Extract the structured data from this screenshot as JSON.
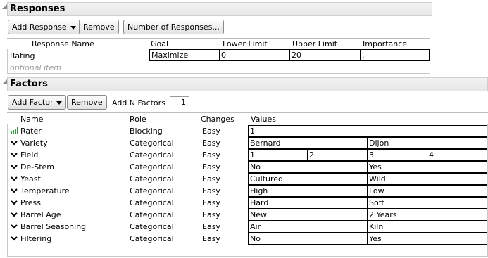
{
  "responses": {
    "title": "Responses",
    "buttons": {
      "add": "Add Response",
      "remove": "Remove",
      "number": "Number of Responses..."
    },
    "columns": [
      "Response Name",
      "Goal",
      "Lower Limit",
      "Upper Limit",
      "Importance"
    ],
    "row": {
      "name": "Rating",
      "goal": "Maximize",
      "lower": "0",
      "upper": "20",
      "importance": "."
    },
    "optional": "optional item"
  },
  "factors": {
    "title": "Factors",
    "buttons": {
      "add": "Add Factor",
      "remove": "Remove",
      "add_n_label": "Add N Factors",
      "add_n_value": "1"
    },
    "columns": [
      "Name",
      "Role",
      "Changes",
      "Values"
    ],
    "rows": [
      {
        "name": "Rater",
        "role": "Blocking",
        "changes": "Easy",
        "icon": "blocking-bars-icon",
        "values": [
          "1"
        ]
      },
      {
        "name": "Variety",
        "role": "Categorical",
        "changes": "Easy",
        "icon": "chevron-down-icon",
        "values": [
          "Bernard",
          "Dijon"
        ]
      },
      {
        "name": "Field",
        "role": "Categorical",
        "changes": "Easy",
        "icon": "chevron-down-icon",
        "values": [
          "1",
          "2",
          "3",
          "4"
        ]
      },
      {
        "name": "De-Stem",
        "role": "Categorical",
        "changes": "Easy",
        "icon": "chevron-down-icon",
        "values": [
          "No",
          "Yes"
        ]
      },
      {
        "name": "Yeast",
        "role": "Categorical",
        "changes": "Easy",
        "icon": "chevron-down-icon",
        "values": [
          "Cultured",
          "Wild"
        ]
      },
      {
        "name": "Temperature",
        "role": "Categorical",
        "changes": "Easy",
        "icon": "chevron-down-icon",
        "values": [
          "High",
          "Low"
        ]
      },
      {
        "name": "Press",
        "role": "Categorical",
        "changes": "Easy",
        "icon": "chevron-down-icon",
        "values": [
          "Hard",
          "Soft"
        ]
      },
      {
        "name": "Barrel Age",
        "role": "Categorical",
        "changes": "Easy",
        "icon": "chevron-down-icon",
        "values": [
          "New",
          "2 Years"
        ]
      },
      {
        "name": "Barrel Seasoning",
        "role": "Categorical",
        "changes": "Easy",
        "icon": "chevron-down-icon",
        "values": [
          "Air",
          "Kiln"
        ]
      },
      {
        "name": "Filtering",
        "role": "Categorical",
        "changes": "Easy",
        "icon": "chevron-down-icon",
        "values": [
          "No",
          "Yes"
        ]
      }
    ]
  }
}
